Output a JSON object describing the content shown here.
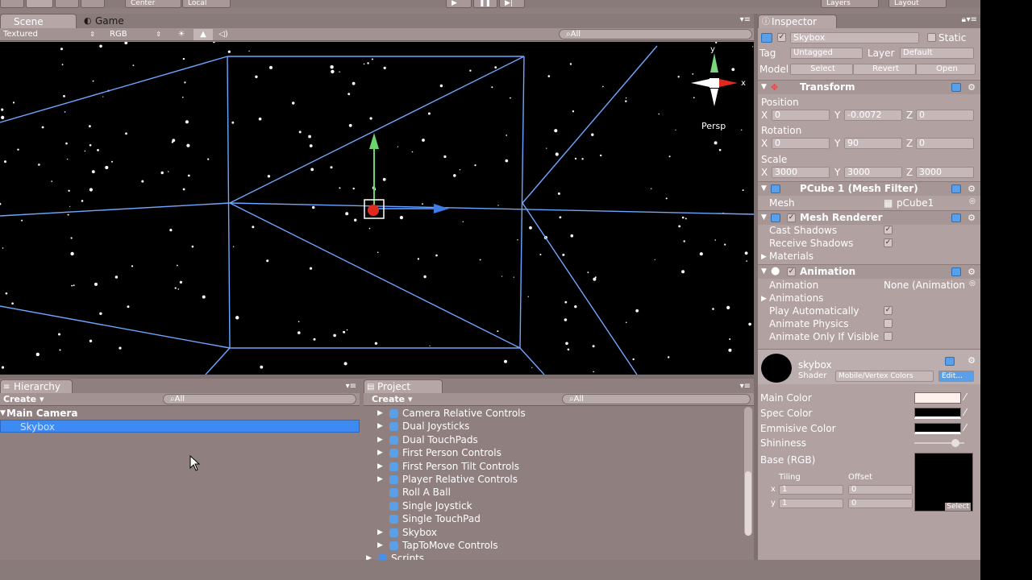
{
  "toolbar": {
    "pivot": "Center",
    "space": "Local",
    "play_icon": "play-icon",
    "pause_icon": "pause-icon",
    "step_icon": "step-icon",
    "layers": "Layers",
    "layout": "Layout"
  },
  "scene": {
    "tabs": [
      {
        "label": "Scene"
      },
      {
        "label": "Game"
      }
    ],
    "render_mode": "Textured",
    "color_mode": "RGB",
    "search_placeholder": "All",
    "gizmo_label": "Persp"
  },
  "inspector": {
    "tab": "Inspector",
    "object_name": "Skybox",
    "static_label": "Static",
    "tag_label": "Tag",
    "tag_value": "Untagged",
    "layer_label": "Layer",
    "layer_value": "Default",
    "model_label": "Model",
    "select_btn": "Select",
    "revert_btn": "Revert",
    "open_btn": "Open",
    "transform": {
      "title": "Transform",
      "position_label": "Position",
      "position": {
        "x": "0",
        "y": "-0.0072",
        "z": "0"
      },
      "rotation_label": "Rotation",
      "rotation": {
        "x": "0",
        "y": "90",
        "z": "0"
      },
      "scale_label": "Scale",
      "scale": {
        "x": "3000",
        "y": "3000",
        "z": "3000"
      }
    },
    "mesh_filter": {
      "title": "PCube 1 (Mesh Filter)",
      "mesh_label": "Mesh",
      "mesh_value": "pCube1"
    },
    "mesh_renderer": {
      "title": "Mesh Renderer",
      "cast_shadows": "Cast Shadows",
      "receive_shadows": "Receive Shadows",
      "materials": "Materials"
    },
    "animation": {
      "title": "Animation",
      "anim_label": "Animation",
      "anim_value": "None (Animation",
      "animations": "Animations",
      "play_auto": "Play Automatically",
      "physics": "Animate Physics",
      "only_visible": "Animate Only If Visible"
    },
    "material": {
      "name": "skybox",
      "shader_label": "Shader",
      "shader_value": "Mobile/Vertex Colors",
      "edit_btn": "Edit...",
      "main_color": "Main Color",
      "spec_color": "Spec Color",
      "emissive_color": "Emmisive Color",
      "shininess": "Shininess",
      "base": "Base (RGB)",
      "tiling": "Tiling",
      "offset": "Offset",
      "tiling_x": "1",
      "tiling_y": "1",
      "offset_x": "0",
      "offset_y": "0",
      "select_btn": "Select"
    }
  },
  "hierarchy": {
    "tab": "Hierarchy",
    "create": "Create",
    "search": "All",
    "items": [
      {
        "label": "Main Camera"
      },
      {
        "label": "Skybox"
      }
    ]
  },
  "project": {
    "tab": "Project",
    "create": "Create",
    "search": "All",
    "items": [
      {
        "label": "Camera Relative Controls"
      },
      {
        "label": "Dual Joysticks"
      },
      {
        "label": "Dual TouchPads"
      },
      {
        "label": "First Person Controls"
      },
      {
        "label": "First Person Tilt Controls"
      },
      {
        "label": "Player Relative Controls"
      },
      {
        "label": "Roll A Ball"
      },
      {
        "label": "Single Joystick"
      },
      {
        "label": "Single TouchPad"
      },
      {
        "label": "Skybox"
      },
      {
        "label": "TapToMove Controls"
      },
      {
        "label": "Scripts"
      }
    ]
  },
  "colors": {
    "accent": "#3e8ef0",
    "selection": "#3d8bf2",
    "panel": "#b1a1a1",
    "wire": "#6fa6ff"
  }
}
